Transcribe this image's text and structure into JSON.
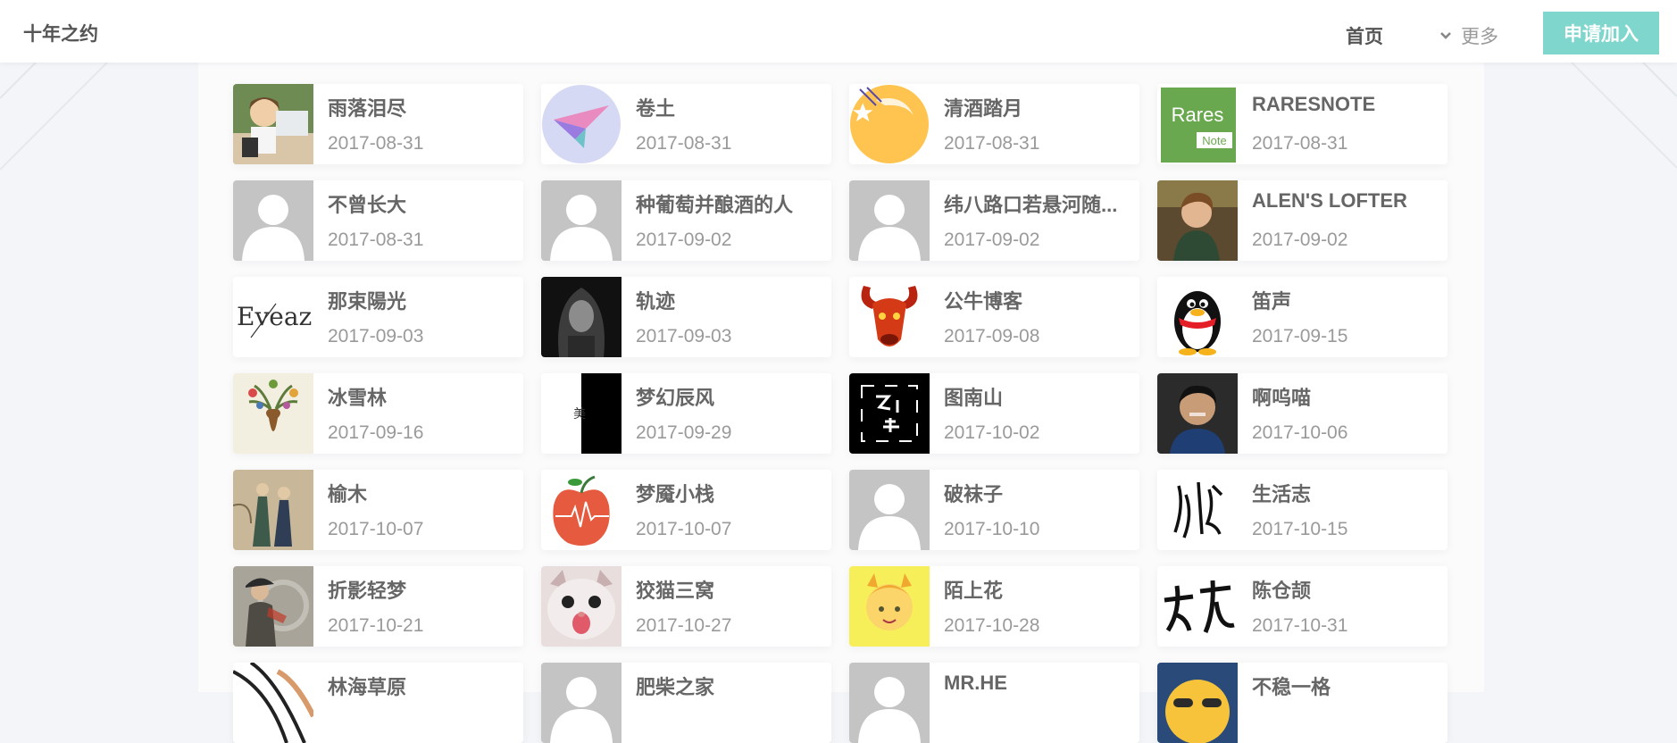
{
  "header": {
    "logo": "十年之约",
    "nav_home": "首页",
    "nav_more": "更多",
    "join_button": "申请加入"
  },
  "members": [
    {
      "name": "雨落泪尽",
      "date": "2017-08-31",
      "avatar": "cartoon-coder"
    },
    {
      "name": "卷土",
      "date": "2017-08-31",
      "avatar": "paper-plane"
    },
    {
      "name": "清酒踏月",
      "date": "2017-08-31",
      "avatar": "qj-moon"
    },
    {
      "name": "RARESNOTE",
      "date": "2017-08-31",
      "avatar": "rares-note",
      "avatar_text": [
        "Rares",
        "Note"
      ]
    },
    {
      "name": "不曾长大",
      "date": "2017-08-31",
      "avatar": "default-user"
    },
    {
      "name": "种葡萄并酿酒的人",
      "date": "2017-09-02",
      "avatar": "default-user"
    },
    {
      "name": "纬八路口若悬河随...",
      "date": "2017-09-02",
      "avatar": "default-user"
    },
    {
      "name": "ALEN'S LOFTER",
      "date": "2017-09-02",
      "avatar": "child-photo"
    },
    {
      "name": "那束陽光",
      "date": "2017-09-03",
      "avatar": "eveaz-text",
      "avatar_text": [
        "Eveaz"
      ]
    },
    {
      "name": "轨迹",
      "date": "2017-09-03",
      "avatar": "hooded-figure"
    },
    {
      "name": "公牛博客",
      "date": "2017-09-08",
      "avatar": "bull-head"
    },
    {
      "name": "笛声",
      "date": "2017-09-15",
      "avatar": "qq-penguin"
    },
    {
      "name": "冰雪林",
      "date": "2017-09-16",
      "avatar": "deer-antlers"
    },
    {
      "name": "梦幻辰风",
      "date": "2017-09-29",
      "avatar": "black-white-split"
    },
    {
      "name": "图南山",
      "date": "2017-10-02",
      "avatar": "black-glyphs"
    },
    {
      "name": "啊呜喵",
      "date": "2017-10-06",
      "avatar": "man-portrait"
    },
    {
      "name": "榆木",
      "date": "2017-10-07",
      "avatar": "painting-couple"
    },
    {
      "name": "梦魇小栈",
      "date": "2017-10-07",
      "avatar": "apple-heartbeat"
    },
    {
      "name": "破袜子",
      "date": "2017-10-10",
      "avatar": "default-user"
    },
    {
      "name": "生活志",
      "date": "2017-10-15",
      "avatar": "calligraphy"
    },
    {
      "name": "折影轻梦",
      "date": "2017-10-21",
      "avatar": "hat-person"
    },
    {
      "name": "狡猫三窝",
      "date": "2017-10-27",
      "avatar": "cat-face"
    },
    {
      "name": "陌上花",
      "date": "2017-10-28",
      "avatar": "yellow-cartoon"
    },
    {
      "name": "陈仓颉",
      "date": "2017-10-31",
      "avatar": "calligraphy-2"
    },
    {
      "name": "林海草原",
      "date": "",
      "avatar": "sketch"
    },
    {
      "name": "肥柴之家",
      "date": "",
      "avatar": "default-user"
    },
    {
      "name": "MR.HE",
      "date": "",
      "avatar": "default-user"
    },
    {
      "name": "不稳一格",
      "date": "",
      "avatar": "emoji-face"
    }
  ],
  "colors": {
    "accent": "#7fd6cc",
    "background": "#f3f5f8",
    "name_text": "#666666",
    "date_text": "#9a9a9a",
    "default_avatar_bg": "#c4c4c4"
  }
}
